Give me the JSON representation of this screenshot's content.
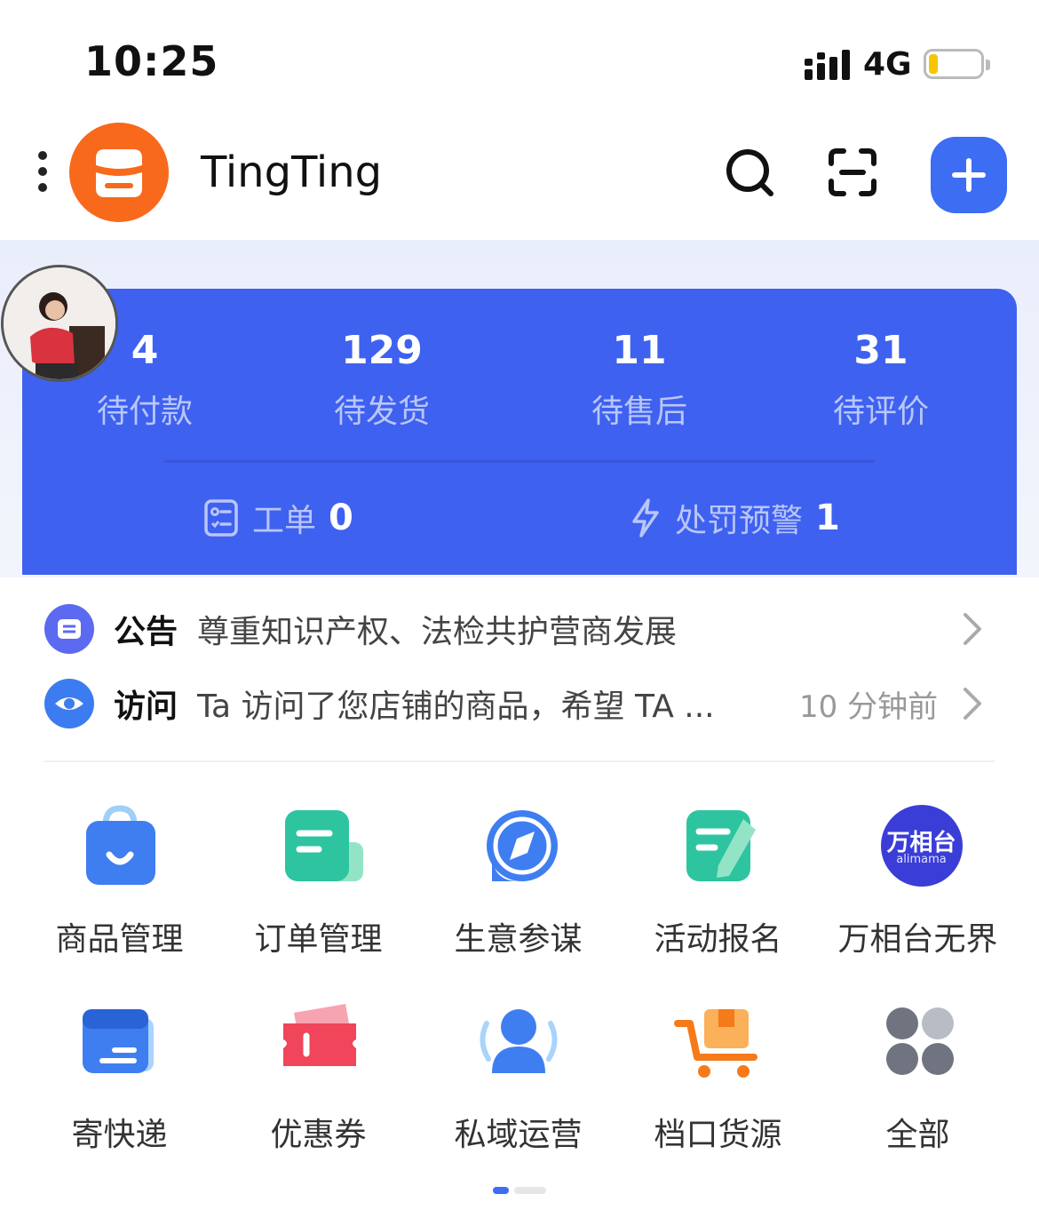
{
  "status_bar": {
    "time": "10:25",
    "network": "4G",
    "battery_level": 0.15
  },
  "header": {
    "store_name": "TingTing"
  },
  "stats": [
    {
      "value": "4",
      "label": "待付款"
    },
    {
      "value": "129",
      "label": "待发货"
    },
    {
      "value": "11",
      "label": "待售后"
    },
    {
      "value": "31",
      "label": "待评价"
    }
  ],
  "sub_stats": [
    {
      "label": "工单",
      "value": "0"
    },
    {
      "label": "处罚预警",
      "value": "1"
    }
  ],
  "notices": [
    {
      "title": "公告",
      "text": "尊重知识产权、法检共护营商发展",
      "time": ""
    },
    {
      "title": "访问",
      "text": "Ta 访问了您店铺的商品，希望 TA ...",
      "time": "10 分钟前"
    }
  ],
  "grid": [
    {
      "label": "商品管理",
      "icon": "shopping-bag-icon"
    },
    {
      "label": "订单管理",
      "icon": "order-icon"
    },
    {
      "label": "生意参谋",
      "icon": "compass-icon"
    },
    {
      "label": "活动报名",
      "icon": "signup-icon"
    },
    {
      "label": "万相台无界",
      "icon": "wanxiangtai-icon",
      "logo_text": "万相台",
      "logo_sub": "alimama"
    },
    {
      "label": "寄快递",
      "icon": "express-icon"
    },
    {
      "label": "优惠券",
      "icon": "coupon-icon"
    },
    {
      "label": "私域运营",
      "icon": "private-domain-icon"
    },
    {
      "label": "档口货源",
      "icon": "cart-icon"
    },
    {
      "label": "全部",
      "icon": "all-apps-icon"
    }
  ],
  "colors": {
    "brand_blue": "#3f61ef",
    "store_orange": "#f8691c",
    "accent_green": "#2ec4a0",
    "coupon_red": "#f0455a"
  }
}
